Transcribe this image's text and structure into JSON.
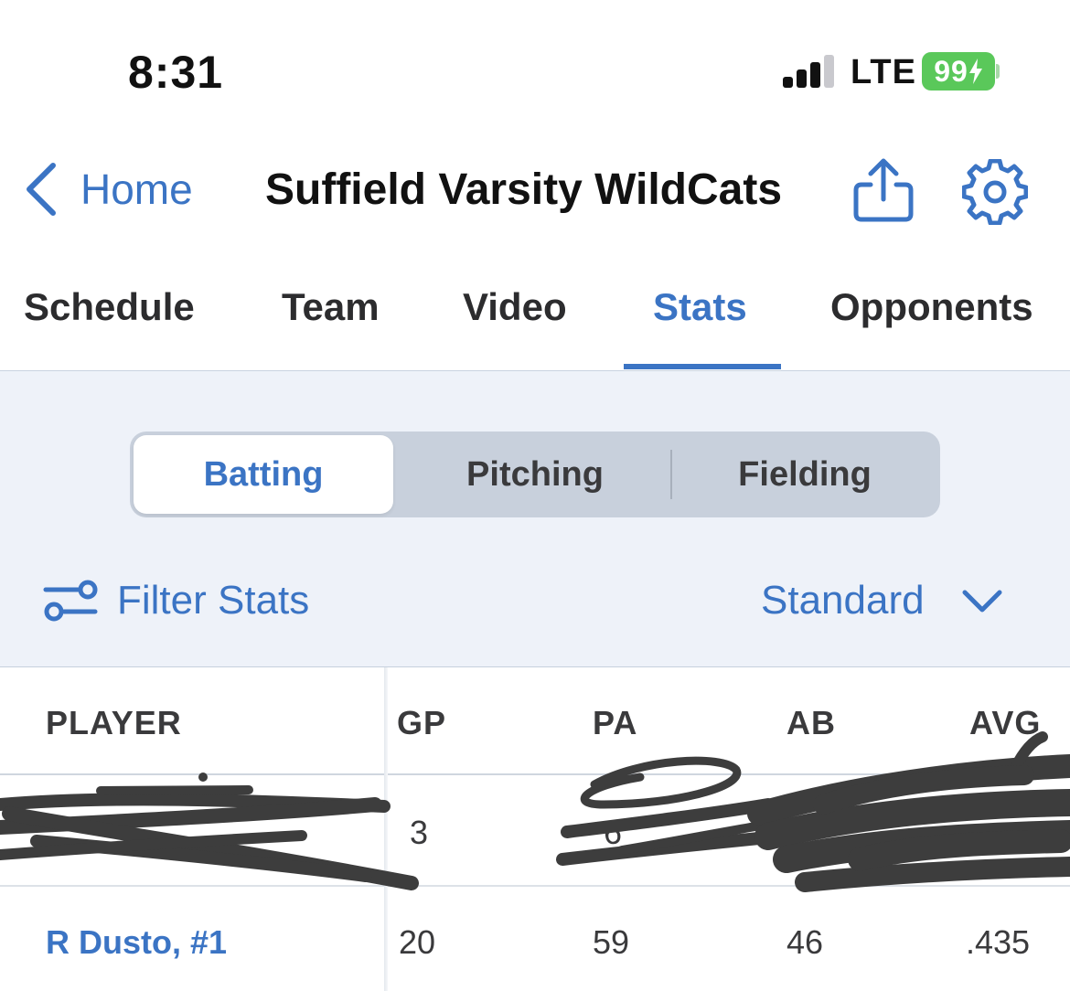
{
  "status_bar": {
    "time": "8:31",
    "network": "LTE",
    "battery": "99"
  },
  "nav": {
    "back_label": "Home",
    "title": "Suffield Varsity WildCats"
  },
  "tabs": [
    {
      "label": "Schedule"
    },
    {
      "label": "Team"
    },
    {
      "label": "Video"
    },
    {
      "label": "Stats"
    },
    {
      "label": "Opponents"
    }
  ],
  "segments": [
    {
      "label": "Batting"
    },
    {
      "label": "Pitching"
    },
    {
      "label": "Fielding"
    }
  ],
  "filter": {
    "label": "Filter Stats",
    "view_label": "Standard"
  },
  "table": {
    "columns": [
      "PLAYER",
      "GP",
      "PA",
      "AB",
      "AVG"
    ],
    "rows": [
      {
        "player": "",
        "gp": "3",
        "pa": "6",
        "ab": "",
        "avg": ""
      },
      {
        "player": "R Dusto, #1",
        "gp": "20",
        "pa": "59",
        "ab": "46",
        "avg": ".435"
      }
    ]
  },
  "colors": {
    "accent": "#3b74c4",
    "battery": "#5ac85a",
    "filter_background": "#eef2f9",
    "segment_track": "#c8d0dc"
  },
  "icons": {
    "back": "chevron-left-icon",
    "share": "share-icon",
    "settings": "gear-icon",
    "filter": "sliders-icon",
    "dropdown": "chevron-down-icon"
  }
}
